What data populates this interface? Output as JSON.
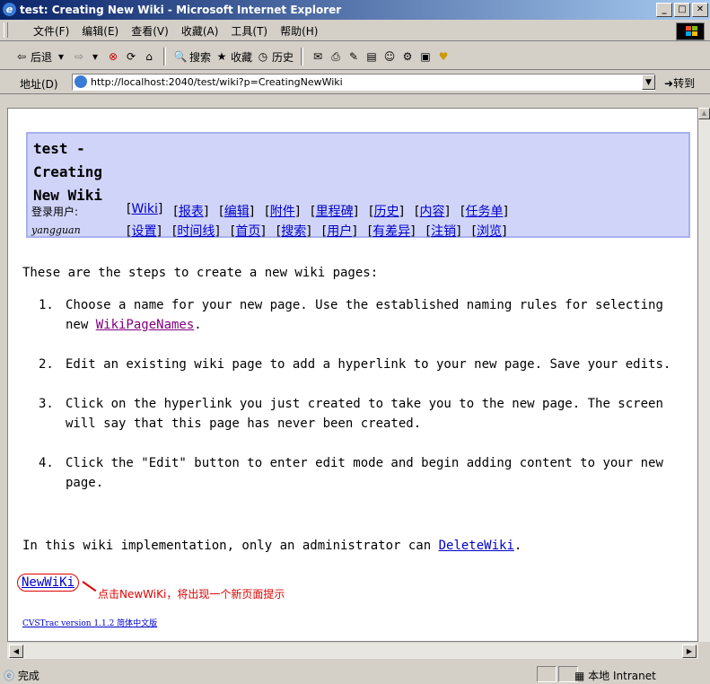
{
  "window": {
    "title": "test: Creating New Wiki - Microsoft Internet Explorer"
  },
  "menu": [
    "文件(F)",
    "编辑(E)",
    "查看(V)",
    "收藏(A)",
    "工具(T)",
    "帮助(H)"
  ],
  "toolbar": {
    "back": "后退",
    "search": "搜索",
    "favorites": "收藏",
    "history": "历史"
  },
  "address": {
    "label": "地址(D)",
    "url": "http://localhost:2040/test/wiki?p=CreatingNewWiki",
    "go": "转到"
  },
  "page": {
    "title": "test - Creating New Wiki",
    "user_label": "登录用户:",
    "user_name": "yangguan",
    "nav_row1": [
      "Wiki",
      "报表",
      "编辑",
      "附件",
      "里程碑",
      "历史",
      "内容",
      "任务单"
    ],
    "nav_row2": [
      "设置",
      "时间线",
      "首页",
      "搜索",
      "用户",
      "有差异",
      "注销",
      "浏览"
    ],
    "intro": "These are the steps to create a new wiki pages:",
    "steps": [
      {
        "num": "1.",
        "text": "Choose a name for your new page. Use the established naming rules for selecting new ",
        "link": "WikiPageNames",
        "after": "."
      },
      {
        "num": "2.",
        "text": "Edit an existing wiki page to add a hyperlink to your new page. Save your edits."
      },
      {
        "num": "3.",
        "text": "Click on the hyperlink you just created to take you to the new page. The screen will say that this page has never been created."
      },
      {
        "num": "4.",
        "text": "Click the \"Edit\" button to enter edit mode and begin adding content to your new page."
      }
    ],
    "admin_text": "In this wiki implementation, only an administrator can ",
    "admin_link": "DeleteWiki",
    "admin_after": ".",
    "new_wiki_link": "NewWiKi",
    "callout": "点击NewWiKi，将出现一个新页面提示",
    "footer": "CVSTrac version 1.1.2 简体中文版"
  },
  "status": {
    "text": "完成",
    "zone": "本地 Intranet"
  }
}
